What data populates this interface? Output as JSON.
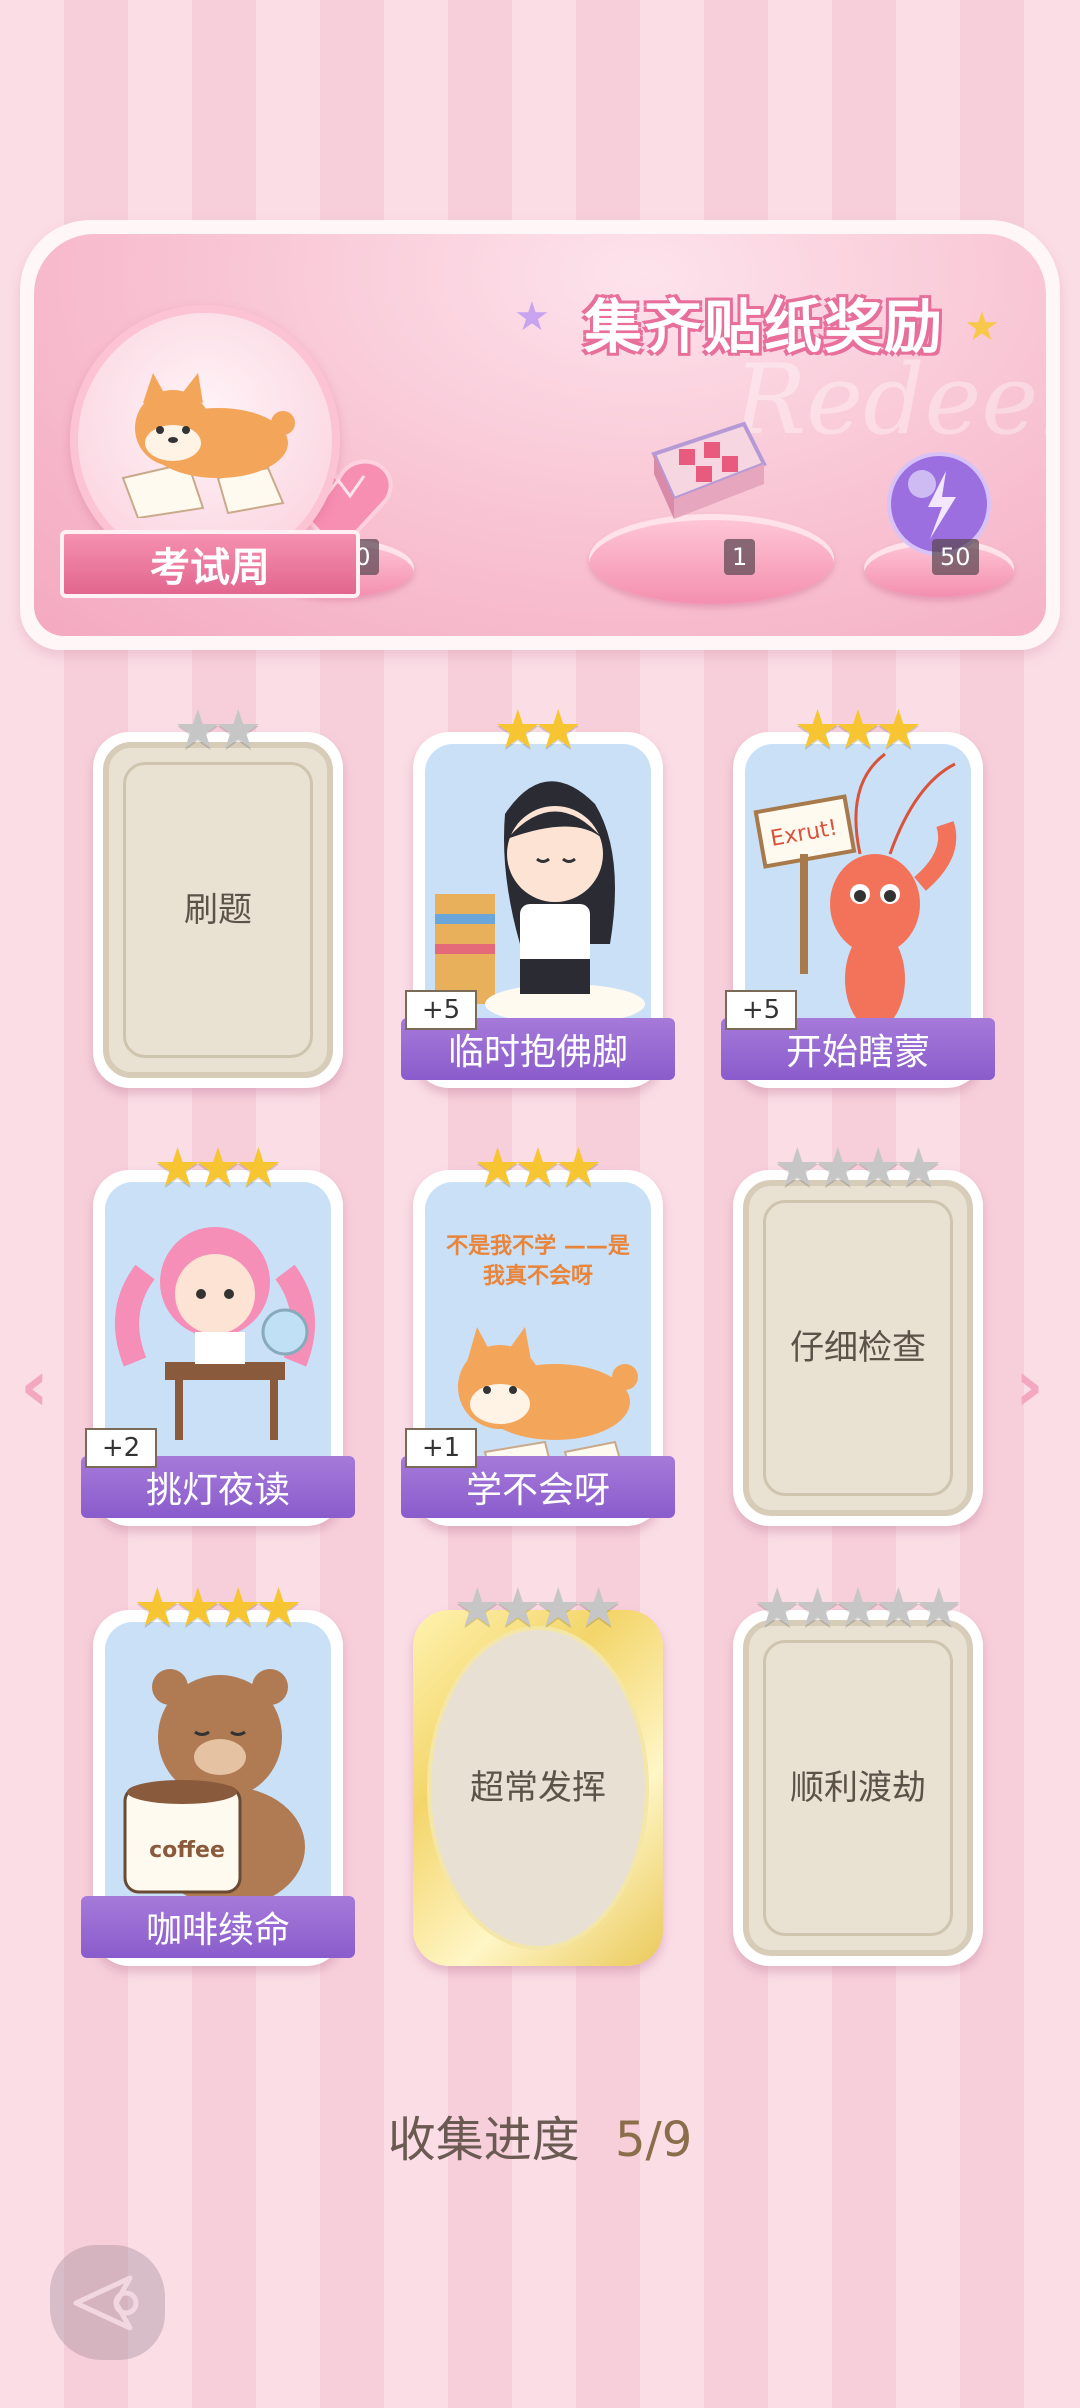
{
  "banner": {
    "title": "集齐贴纸奖励",
    "watermark": "Redeem",
    "event_name": "考试周",
    "rewards": [
      {
        "icon": "pink-heart-gem-icon",
        "count": "50"
      },
      {
        "icon": "gift-box-icon",
        "count": "1"
      },
      {
        "icon": "purple-energy-orb-icon",
        "count": "50"
      }
    ]
  },
  "cards": [
    {
      "name": "刷题",
      "collected": false,
      "stars_filled": 0,
      "stars_total": 2
    },
    {
      "name": "临时抱佛脚",
      "collected": true,
      "stars_filled": 2,
      "stars_total": 2,
      "bonus": "+5"
    },
    {
      "name": "开始瞎蒙",
      "collected": true,
      "stars_filled": 3,
      "stars_total": 3,
      "bonus": "+5"
    },
    {
      "name": "挑灯夜读",
      "collected": true,
      "stars_filled": 3,
      "stars_total": 3,
      "bonus": "+2"
    },
    {
      "name": "学不会呀",
      "collected": true,
      "stars_filled": 3,
      "stars_total": 3,
      "bonus": "+1",
      "art_text": "不是我不学 ——是我真不会呀"
    },
    {
      "name": "仔细检查",
      "collected": false,
      "stars_filled": 0,
      "stars_total": 4
    },
    {
      "name": "咖啡续命",
      "collected": true,
      "stars_filled": 4,
      "stars_total": 4,
      "art_text": "coffee"
    },
    {
      "name": "超常发挥",
      "collected": false,
      "stars_filled": 0,
      "stars_total": 4
    },
    {
      "name": "顺利渡劫",
      "collected": false,
      "stars_filled": 0,
      "stars_total": 5
    }
  ],
  "progress": {
    "label": "收集进度",
    "value": "5/9"
  },
  "colors": {
    "accent_pink": "#e86f9a",
    "label_purple": "#8a5ccc",
    "star_gold": "#f6c531",
    "star_gray": "#c6c6c6"
  }
}
